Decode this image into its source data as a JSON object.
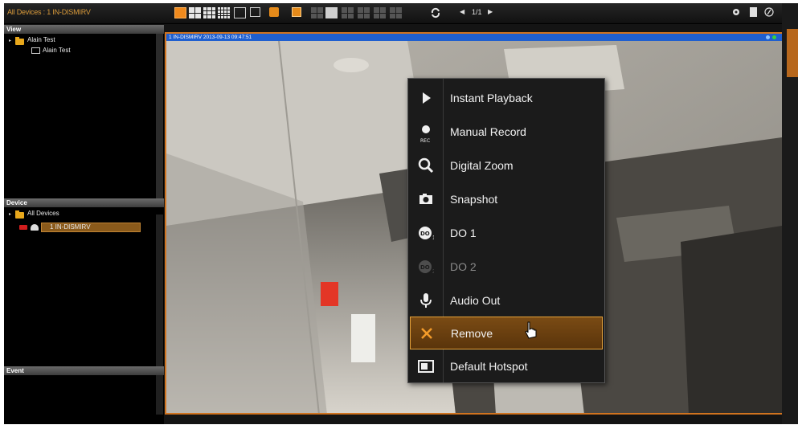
{
  "header": {
    "title": "All Devices : 1 IN-DISMIRV",
    "pager": {
      "label": "1/1"
    }
  },
  "left_panel": {
    "view_section": {
      "title": "View",
      "group": "Alain Test",
      "item": "Alain Test"
    },
    "device_section": {
      "title": "Device",
      "group": "All Devices",
      "selected_device": "1 IN-DISMIRV"
    },
    "event_section": {
      "title": "Event"
    }
  },
  "video": {
    "caption": "1 IN-DISMIRV   2013-09-13 09:47:51"
  },
  "context_menu": {
    "items": [
      {
        "label": "Instant Playback",
        "icon": "play-icon"
      },
      {
        "label": "Manual Record",
        "icon": "record-icon",
        "icon_text": "REC"
      },
      {
        "label": "Digital Zoom",
        "icon": "magnifier-icon"
      },
      {
        "label": "Snapshot",
        "icon": "camera-icon"
      },
      {
        "label": "DO 1",
        "icon": "digital-output-1-icon",
        "icon_text": "DO"
      },
      {
        "label": "DO 2",
        "icon": "digital-output-2-icon",
        "icon_text": "DO",
        "disabled": true
      },
      {
        "label": "Audio Out",
        "icon": "microphone-icon"
      },
      {
        "label": "Remove",
        "icon": "close-x-icon",
        "highlighted": true
      },
      {
        "label": "Default Hotspot",
        "icon": "hotspot-icon"
      }
    ]
  },
  "colors": {
    "accent_orange": "#d0731f",
    "video_title_blue": "#1f5fcf",
    "highlight_gold": "#e7a33a"
  }
}
